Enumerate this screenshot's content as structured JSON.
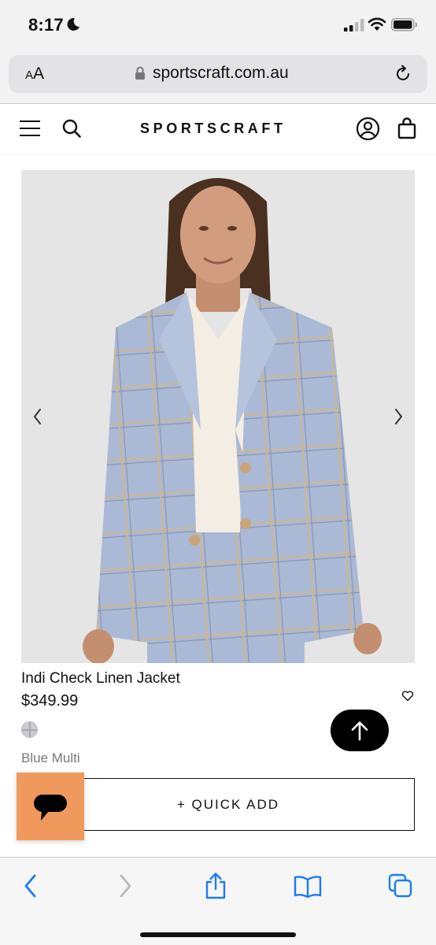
{
  "status_bar": {
    "time": "8:17",
    "icons": [
      "moon-icon",
      "signal-icon",
      "wifi-icon",
      "battery-icon"
    ]
  },
  "browser": {
    "text_size_label": "AA",
    "url": "sportscraft.com.au",
    "icons": [
      "lock-icon",
      "reload-icon"
    ],
    "toolbar_icons": [
      "back-icon",
      "forward-icon",
      "share-icon",
      "bookmarks-icon",
      "tabs-icon"
    ]
  },
  "site_header": {
    "brand": "SPORTSCRAFT",
    "icons": [
      "menu-icon",
      "search-icon",
      "account-icon",
      "bag-icon"
    ]
  },
  "product": {
    "name": "Indi Check Linen Jacket",
    "price": "$349.99",
    "colour": "Blue Multi",
    "quick_add_label": "+ QUICK ADD",
    "image_icons": [
      "chevron-left-icon",
      "chevron-right-icon"
    ],
    "wishlist_icon": "heart-icon"
  },
  "floating": {
    "back_to_top_icon": "arrow-up-icon",
    "chat_icon": "chat-bubble-icon"
  },
  "colors": {
    "chat_button": "#ef9a5c",
    "ios_blue": "#1b7cf5",
    "jacket": "#a9b8d4"
  }
}
